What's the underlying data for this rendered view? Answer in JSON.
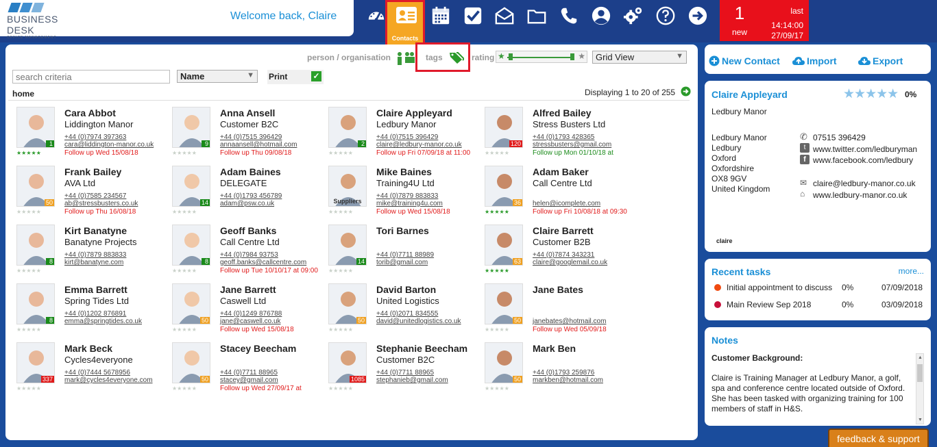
{
  "brand": {
    "name": "BUSINESS DESK",
    "sub": "OFFICE MANAGEMENT"
  },
  "welcome": "Welcome back, Claire",
  "nav": {
    "contacts_label": "Contacts"
  },
  "notification": {
    "count": "1",
    "new": "new",
    "last": "last",
    "time": "14:14:00",
    "date": "27/09/17"
  },
  "filters": {
    "person_org": "person / organisation",
    "tags": "tags",
    "rating": "rating",
    "view": "Grid View",
    "search_placeholder": "search criteria",
    "sort": "Name",
    "print": "Print",
    "breadcrumb": "home",
    "displaying": "Displaying 1 to 20 of 255"
  },
  "contacts": [
    {
      "name": "Cara Abbot",
      "company": "Liddington Manor",
      "phone": "+44 (0)7974 397363",
      "email": "cara@liddington-manor.co.uk",
      "follow": "Follow up Wed 15/08/18",
      "badge": "1",
      "badge_color": "#1a8a1a",
      "stars_on": 5
    },
    {
      "name": "Anna Ansell",
      "company": "Customer B2C",
      "phone": "+44 (0)7515 396429",
      "email": "annaansell@hotmail.com",
      "follow": "Follow up Thu 09/08/18",
      "badge": "9",
      "badge_color": "#1a8a1a",
      "stars_on": 0
    },
    {
      "name": "Claire Appleyard",
      "company": "Ledbury Manor",
      "phone": "+44 (0)7515 396429",
      "email": "claire@ledbury-manor.co.uk",
      "follow": "Follow up Fri 07/09/18 at 11:00",
      "badge": "2",
      "badge_color": "#1a8a1a",
      "stars_on": 0
    },
    {
      "name": "Alfred Bailey",
      "company": "Stress Busters Ltd",
      "phone": "+44 (0)1793 428365",
      "email": "stressbusters@gmail.com",
      "follow": "Follow up Mon 01/10/18 at",
      "follow_color": "#1a8a1a",
      "badge": "120",
      "badge_color": "#e01a1a",
      "stars_on": 0
    },
    {
      "name": "Frank Bailey",
      "company": "AVA Ltd",
      "phone": "+44 (0)7585 234567",
      "email": "ab@stressbusters.co.uk",
      "follow": "Follow up Thu 16/08/18",
      "badge": "50",
      "badge_color": "#f0a020",
      "stars_on": 0
    },
    {
      "name": "Adam Baines",
      "company": "DELEGATE",
      "phone": "+44 (0)1793 456789",
      "email": "adam@psw.co.uk",
      "follow": "",
      "badge": "14",
      "badge_color": "#1a8a1a",
      "stars_on": 0
    },
    {
      "name": "Mike Baines",
      "company": "Training4U Ltd",
      "phone": "+44 (0)7879 883833",
      "email": "mike@training4u.com",
      "follow": "Follow up Wed 15/08/18",
      "badge": "",
      "badge_color": "",
      "stars_on": 0,
      "photo_label": "Suppliers"
    },
    {
      "name": "Adam Baker",
      "company": "Call Centre Ltd",
      "phone": "",
      "email": "helen@icomplete.com",
      "follow": "Follow up Fri 10/08/18 at 09:30",
      "badge": "36",
      "badge_color": "#f0a020",
      "stars_on": 5
    },
    {
      "name": "Kirt Banatyne",
      "company": "Banatyne Projects",
      "phone": "+44 (0)7879 883833",
      "email": "kirt@banatyne.com",
      "follow": "",
      "badge": "8",
      "badge_color": "#1a8a1a",
      "stars_on": 0
    },
    {
      "name": "Geoff Banks",
      "company": "Call Centre Ltd",
      "phone": "+44 (0)7984 93753",
      "email": "geoff.banks@callcentre.com",
      "follow": "Follow up Tue 10/10/17 at 09:00",
      "badge": "8",
      "badge_color": "#1a8a1a",
      "stars_on": 0
    },
    {
      "name": "Tori Barnes",
      "company": "",
      "phone": "+44 (0)7711 88989",
      "email": "torib@gmail.com",
      "follow": "",
      "badge": "14",
      "badge_color": "#1a8a1a",
      "stars_on": 0
    },
    {
      "name": "Claire Barrett",
      "company": "Customer B2B",
      "phone": "+44 (0)7874 343231",
      "email": "claire@googlemail.co.uk",
      "follow": "",
      "badge": "63",
      "badge_color": "#f0a020",
      "stars_on": 5
    },
    {
      "name": "Emma Barrett",
      "company": "Spring Tides Ltd",
      "phone": "+44 (0)1202 876891",
      "email": "emma@springtides.co.uk",
      "follow": "",
      "badge": "8",
      "badge_color": "#1a8a1a",
      "stars_on": 0
    },
    {
      "name": "Jane Barrett",
      "company": "Caswell Ltd",
      "phone": "+44 (0)1249 876788",
      "email": "jane@caswell.co.uk",
      "follow": "Follow up Wed 15/08/18",
      "badge": "50",
      "badge_color": "#f0a020",
      "stars_on": 0
    },
    {
      "name": "David Barton",
      "company": "United Logistics",
      "phone": "+44 (0)2071 834555",
      "email": "david@unitedlogistics.co.uk",
      "follow": "",
      "badge": "50",
      "badge_color": "#f0a020",
      "stars_on": 0
    },
    {
      "name": "Jane Bates",
      "company": "",
      "phone": "",
      "email": "janebates@hotmail.com",
      "follow": "Follow up Wed 05/09/18",
      "badge": "50",
      "badge_color": "#f0a020",
      "stars_on": 0
    },
    {
      "name": "Mark Beck",
      "company": "Cycles4everyone",
      "phone": "+44 (0)7444 5678956",
      "email": "mark@cycles4everyone.com",
      "follow": "",
      "badge": "337",
      "badge_color": "#e01a1a",
      "stars_on": 0
    },
    {
      "name": "Stacey Beecham",
      "company": "",
      "phone": "+44 (0)7711 88965",
      "email": "stacey@gmail.com",
      "follow": "Follow up Wed 27/09/17 at",
      "badge": "50",
      "badge_color": "#f0a020",
      "stars_on": 0
    },
    {
      "name": "Stephanie Beecham",
      "company": "Customer B2C",
      "phone": "+44 (0)7711 88965",
      "email": "stephanieb@gmail.com",
      "follow": "",
      "badge": "1085",
      "badge_color": "#e01a1a",
      "stars_on": 0
    },
    {
      "name": "Mark Ben",
      "company": "",
      "phone": "+44 (0)1793 259876",
      "email": "markben@hotmail.com",
      "follow": "",
      "badge": "50",
      "badge_color": "#f0a020",
      "stars_on": 0
    }
  ],
  "actions": {
    "new_contact": "New Contact",
    "import": "Import",
    "export": "Export"
  },
  "detail": {
    "name": "Claire Appleyard",
    "rating_pct": "0%",
    "company": "Ledbury Manor",
    "address": [
      "Ledbury Manor",
      "Ledbury",
      "Oxford",
      "Oxfordshire",
      "OX8 9GV",
      "United Kingdom"
    ],
    "phone": "07515 396429",
    "twitter": "www.twitter.com/ledburyman",
    "facebook": "www.facebook.com/ledbury",
    "email": "claire@ledbury-manor.co.uk",
    "web": "www.ledbury-manor.co.uk",
    "tag": "claire"
  },
  "tasks": {
    "title": "Recent tasks",
    "more": "more...",
    "items": [
      {
        "name": "Initial appointment to discuss",
        "pct": "0%",
        "date": "07/09/2018",
        "color": "#f04a10"
      },
      {
        "name": "Main Review Sep 2018",
        "pct": "0%",
        "date": "03/09/2018",
        "color": "#c8103a"
      }
    ]
  },
  "notes": {
    "title": "Notes",
    "heading": "Customer Background:",
    "body": "Claire is Training Manager at Ledbury Manor, a golf, spa and conference centre located outside of Oxford.  She has been tasked with organizing training for 100 members of staff in H&S."
  },
  "feedback": "feedback & support"
}
